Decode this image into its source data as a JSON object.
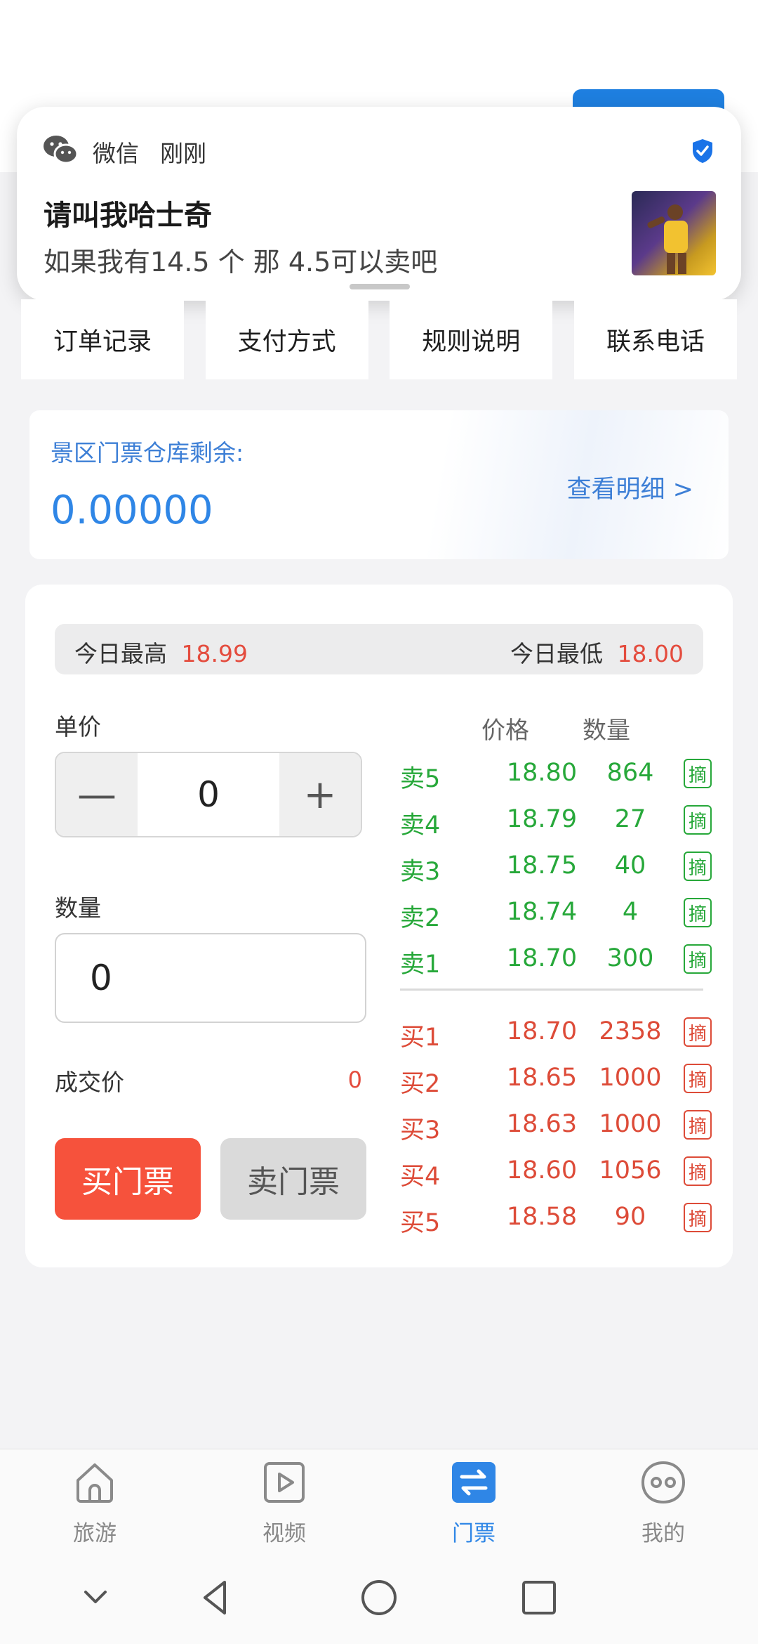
{
  "notification": {
    "app": "微信",
    "time": "刚刚",
    "title": "请叫我哈士奇",
    "body": "如果我有14.5 个 那 4.5可以卖吧"
  },
  "menu": [
    "订单记录",
    "支付方式",
    "规则说明",
    "联系电话"
  ],
  "stock": {
    "label": "景区门票仓库剩余:",
    "value": "0.00000",
    "detail_link": "查看明细 >"
  },
  "daily": {
    "high_label": "今日最高",
    "high_value": "18.99",
    "low_label": "今日最低",
    "low_value": "18.00"
  },
  "form": {
    "price_label": "单价",
    "price_value": "0",
    "minus": "—",
    "plus": "+",
    "qty_label": "数量",
    "qty_value": "0",
    "deal_label": "成交价",
    "deal_value": "0",
    "buy_button": "买门票",
    "sell_button": "卖门票"
  },
  "orderbook": {
    "headers": {
      "price": "价格",
      "qty": "数量"
    },
    "asks": [
      {
        "side": "卖5",
        "price": "18.80",
        "qty": "864",
        "tag": "摘"
      },
      {
        "side": "卖4",
        "price": "18.79",
        "qty": "27",
        "tag": "摘"
      },
      {
        "side": "卖3",
        "price": "18.75",
        "qty": "40",
        "tag": "摘"
      },
      {
        "side": "卖2",
        "price": "18.74",
        "qty": "4",
        "tag": "摘"
      },
      {
        "side": "卖1",
        "price": "18.70",
        "qty": "300",
        "tag": "摘"
      }
    ],
    "bids": [
      {
        "side": "买1",
        "price": "18.70",
        "qty": "2358",
        "tag": "摘"
      },
      {
        "side": "买2",
        "price": "18.65",
        "qty": "1000",
        "tag": "摘"
      },
      {
        "side": "买3",
        "price": "18.63",
        "qty": "1000",
        "tag": "摘"
      },
      {
        "side": "买4",
        "price": "18.60",
        "qty": "1056",
        "tag": "摘"
      },
      {
        "side": "买5",
        "price": "18.58",
        "qty": "90",
        "tag": "摘"
      }
    ]
  },
  "tabs": [
    {
      "label": "旅游",
      "icon": "home-icon"
    },
    {
      "label": "视频",
      "icon": "video-play-icon"
    },
    {
      "label": "门票",
      "icon": "exchange-icon",
      "active": true
    },
    {
      "label": "我的",
      "icon": "profile-face-icon"
    }
  ],
  "colors": {
    "accent": "#2f86e6",
    "buy": "#f6523c",
    "ask_green": "#27a83a",
    "bid_red": "#dd4b38"
  }
}
